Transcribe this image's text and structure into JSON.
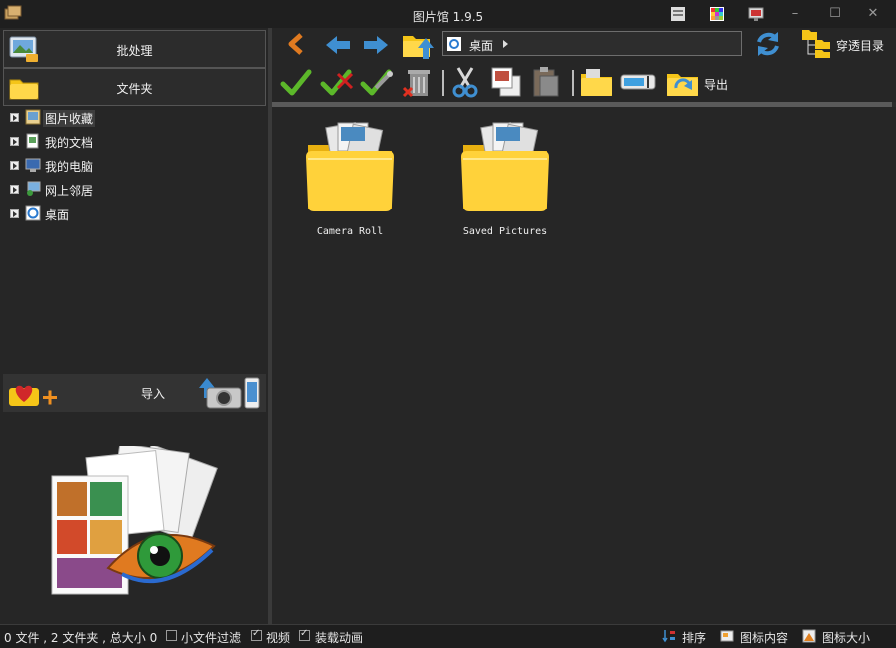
{
  "window": {
    "title": "图片馆 1.9.5",
    "controls": {
      "minimize": "–",
      "maximize": "☐",
      "close": "✕"
    }
  },
  "left_panel": {
    "batch_button": {
      "label": "批处理",
      "icon": "batch-photo-icon"
    },
    "folder_button": {
      "label": "文件夹",
      "icon": "folder-icon"
    },
    "tree": [
      {
        "label": "图片收藏",
        "icon": "picture-collection-icon",
        "selected": true
      },
      {
        "label": "我的文档",
        "icon": "documents-icon",
        "selected": false
      },
      {
        "label": "我的电脑",
        "icon": "computer-icon",
        "selected": false
      },
      {
        "label": "网上邻居",
        "icon": "network-icon",
        "selected": false
      },
      {
        "label": "桌面",
        "icon": "desktop-icon",
        "selected": false
      }
    ],
    "import": {
      "label": "导入",
      "icon_left": "heart-plus-icon",
      "icon_right": "camera-phone-icon"
    }
  },
  "toolbar": {
    "address": {
      "text": "桌面"
    },
    "tree_mode_label": "穿透目录",
    "export_label": "导出"
  },
  "content": {
    "items": [
      {
        "label": "Camera Roll",
        "icon": "photo-folder-icon"
      },
      {
        "label": "Saved Pictures",
        "icon": "photo-folder-icon"
      }
    ]
  },
  "statusbar": {
    "summary": "0 文件 , 2 文件夹 , 总大小 0",
    "filter_small_label": "小文件过滤",
    "filter_small_checked": false,
    "video_label": "视频",
    "video_checked": true,
    "load_anim_label": "装载动画",
    "load_anim_checked": true,
    "sort_label": "排序",
    "icon_content_label": "图标内容",
    "icon_size_label": "图标大小"
  },
  "colors": {
    "background": "#262626",
    "titlebar": "#1f1f1f",
    "folder_yellow": "#f5c518",
    "accent_blue": "#3f8fd1"
  }
}
